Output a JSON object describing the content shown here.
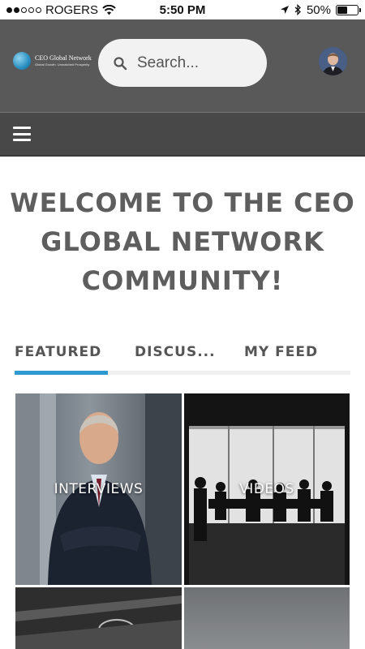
{
  "status_bar": {
    "carrier": "ROGERS",
    "time": "5:50 PM",
    "battery": "50%",
    "battery_level": 0.5,
    "icons": [
      "signal-dots",
      "wifi-icon",
      "location-arrow-icon",
      "bluetooth-icon",
      "battery-icon"
    ]
  },
  "header": {
    "logo_name": "CEO Global Network",
    "logo_tagline": "Global Growth. Unmatched Prosperity",
    "search_placeholder": "Search...",
    "background": "#595959"
  },
  "nav": {
    "menu_icon": "hamburger-menu-icon",
    "background": "#484848"
  },
  "welcome_title": "WELCOME TO THE CEO GLOBAL NETWORK COMMUNITY!",
  "tabs": [
    {
      "label": "FEATURED",
      "active": true
    },
    {
      "label": "DISCUS...",
      "active": false
    },
    {
      "label": "MY FEED",
      "active": false
    }
  ],
  "accent_color": "#2e9ad0",
  "tiles": [
    {
      "label": "INTERVIEWS"
    },
    {
      "label": "VIDEOS"
    },
    {
      "label": ""
    },
    {
      "label": ""
    }
  ]
}
